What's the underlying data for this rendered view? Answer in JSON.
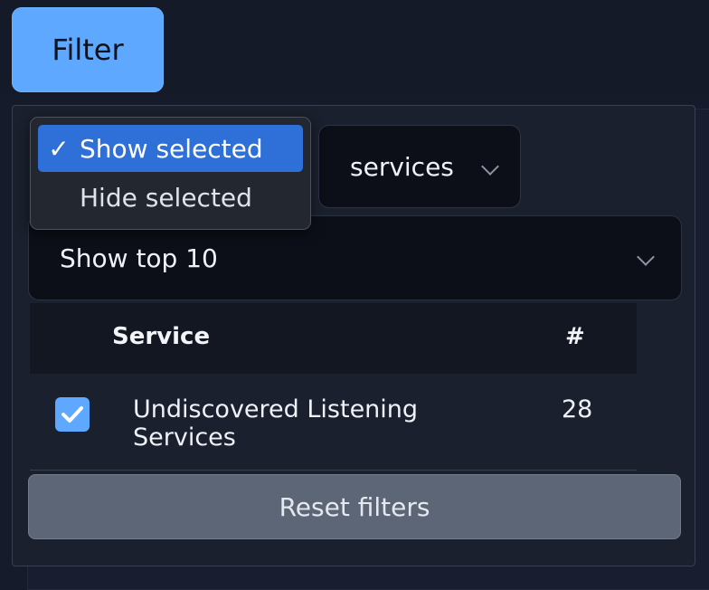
{
  "filter_button": {
    "label": "Filter"
  },
  "selection_menu": {
    "options": [
      {
        "label": "Show selected",
        "checked": true
      },
      {
        "label": "Hide selected",
        "checked": false
      }
    ],
    "check_glyph": "✓"
  },
  "services_dropdown": {
    "value": "services"
  },
  "top_dropdown": {
    "value": "Show top 10"
  },
  "table": {
    "columns": [
      "Service",
      "#"
    ],
    "rows": [
      {
        "checked": true,
        "service": "Undiscovered Listening Services",
        "count": "28"
      }
    ]
  },
  "reset_button": {
    "label": "Reset filters"
  },
  "colors": {
    "accent": "#5ea8ff",
    "menu_highlight": "#2f6fd8",
    "background": "#161b2b"
  },
  "icons": {
    "dropdown_chevron": "chevron-down-icon",
    "checkbox_check": "checkmark-icon"
  }
}
